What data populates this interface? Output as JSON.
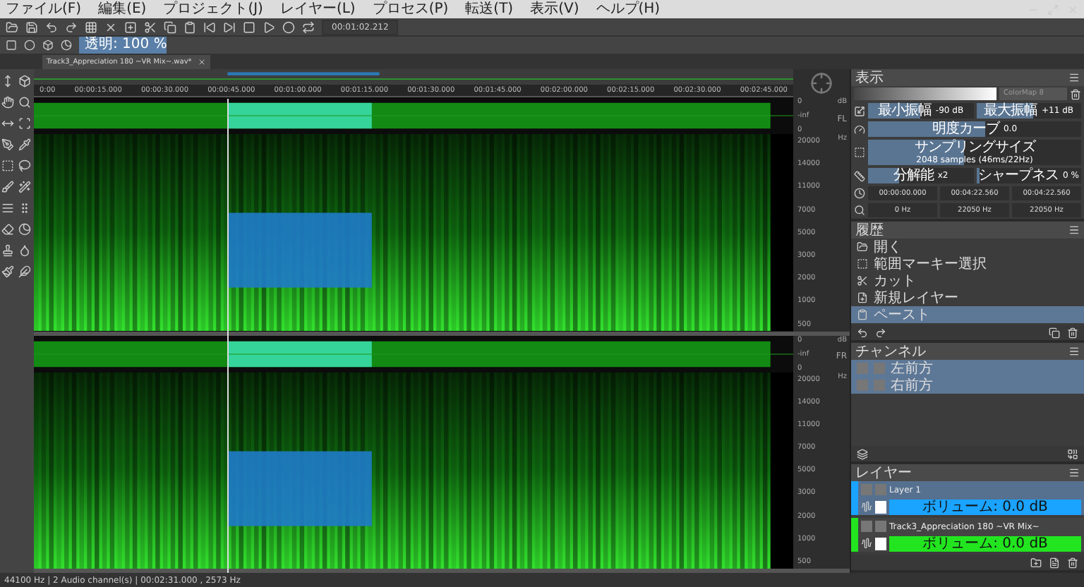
{
  "menu": [
    "ファイル(F)",
    "編集(E)",
    "プロジェクト(J)",
    "レイヤー(L)",
    "プロセス(P)",
    "転送(T)",
    "表示(V)",
    "ヘルプ(H)"
  ],
  "toolbar": {
    "time": "00:01:02.212"
  },
  "opacity_field": {
    "label": "透明: 100 %",
    "level": 1
  },
  "tab": {
    "title": "Track3_Appreciation 180 ~VR Mix~.wav*"
  },
  "ruler": [
    "0:00",
    "00:00:15.000",
    "00:00:30.000",
    "00:00:45.000",
    "00:01:00.000",
    "00:01:15.000",
    "00:01:30.000",
    "00:01:45.000",
    "00:02:00.000",
    "00:02:15.000",
    "00:02:30.000",
    "00:02:45.000"
  ],
  "tracks": [
    {
      "label": "FL",
      "has_selection": true,
      "db_labels": [
        "0",
        "-inf",
        "0"
      ],
      "freq_labels": [
        "20000",
        "14000",
        "11000",
        "7000",
        "5000",
        "3000",
        "2000",
        "1000",
        "500"
      ],
      "db_unit": "dB",
      "freq_unit": "Hz"
    },
    {
      "label": "FR",
      "has_selection": true,
      "db_labels": [
        "0",
        "-inf",
        "0"
      ],
      "freq_labels": [
        "20000",
        "14000",
        "11000",
        "7000",
        "5000",
        "3000",
        "2000",
        "1000",
        "500"
      ],
      "db_unit": "dB",
      "freq_unit": "Hz"
    }
  ],
  "display_panel": {
    "title": "表示",
    "colormap": "ColorMap 8",
    "rows": [
      {
        "kind": "sliders",
        "sliders": [
          {
            "label": "最小振幅",
            "value": "-90 dB",
            "level": 0.5
          },
          {
            "label": "最大振幅",
            "value": "+11 dB",
            "level": 0.55
          }
        ]
      },
      {
        "kind": "sliders",
        "sliders": [
          {
            "label": "明度カーブ",
            "value": "0.0",
            "level": 0.55
          }
        ]
      },
      {
        "kind": "sliders",
        "sliders": [
          {
            "label": "サンプリングサイズ",
            "value": "2048 samples (46ms/22Hz)",
            "level": 0.45
          }
        ]
      },
      {
        "kind": "sliders",
        "sliders": [
          {
            "label": "分解能",
            "value": "x2",
            "level": 0.3
          },
          {
            "label": "シャープネス",
            "value": "0 %",
            "level": 0
          }
        ]
      },
      {
        "kind": "fields",
        "fields": [
          "00:00:00.000",
          "00:04:22.560",
          "00:04:22.560"
        ]
      },
      {
        "kind": "fields",
        "fields": [
          "0 Hz",
          "22050 Hz",
          "22050 Hz"
        ]
      }
    ]
  },
  "history_panel": {
    "title": "履歴",
    "items": [
      {
        "label": "開く",
        "selected": false
      },
      {
        "label": "範囲マーキー選択",
        "selected": false
      },
      {
        "label": "カット",
        "selected": false
      },
      {
        "label": "新規レイヤー",
        "selected": false
      },
      {
        "label": "ペースト",
        "selected": true
      }
    ]
  },
  "channels_panel": {
    "title": "チャンネル",
    "items": [
      {
        "label": "左前方",
        "selected": true
      },
      {
        "label": "右前方",
        "selected": true
      }
    ]
  },
  "layers_panel": {
    "title": "レイヤー",
    "items": [
      {
        "name": "Layer 1",
        "color": "#1aa3ff",
        "volume": "ボリューム: 0.0 dB",
        "selected": true
      },
      {
        "name": "Track3_Appreciation 180 ~VR Mix~",
        "color": "#22e51f",
        "volume": "ボリューム: 0.0 dB",
        "selected": false
      }
    ]
  },
  "status_bar": "44100 Hz | 2 Audio channel(s) | 00:02:31.000 , 2573 Hz"
}
